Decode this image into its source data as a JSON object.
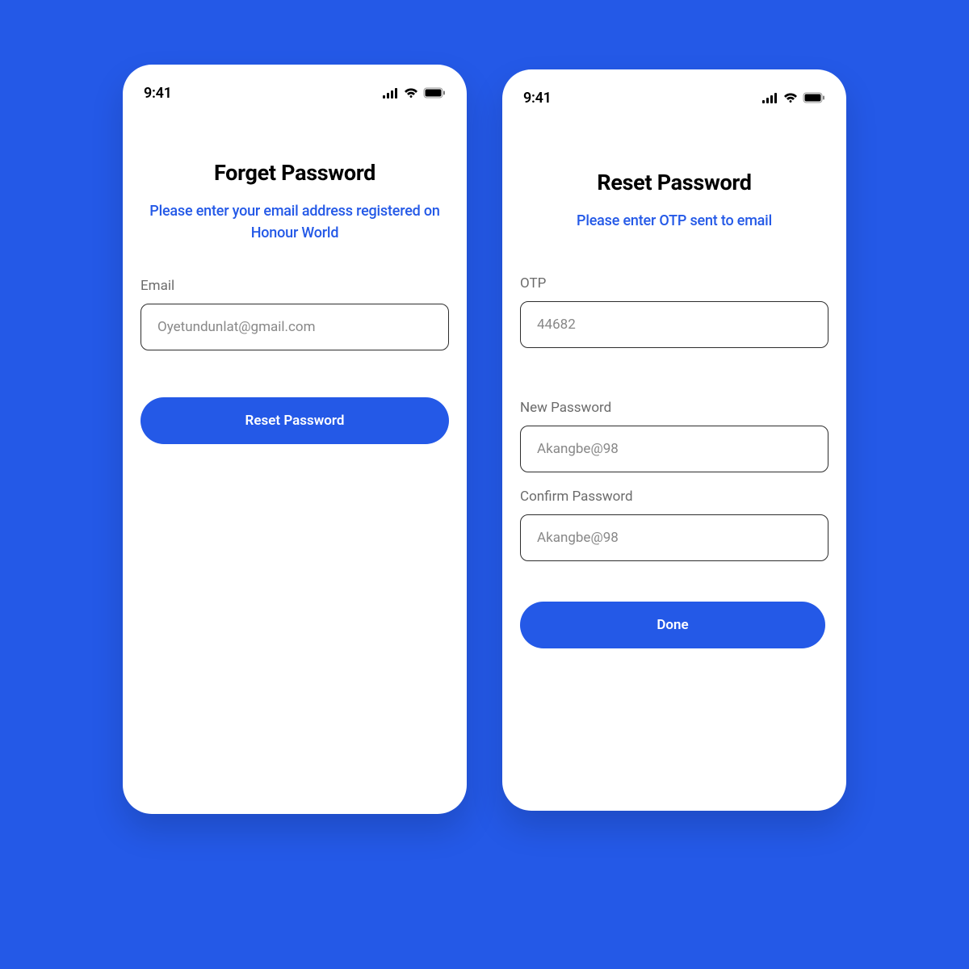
{
  "status": {
    "time": "9:41"
  },
  "screen1": {
    "title": "Forget Password",
    "subtitle": "Please enter your email address registered on Honour World",
    "email_label": "Email",
    "email_placeholder": "Oyetundunlat@gmail.com",
    "button_label": "Reset Password"
  },
  "screen2": {
    "title": "Reset Password",
    "subtitle": "Please enter OTP sent to email",
    "otp_label": "OTP",
    "otp_placeholder": "44682",
    "newpass_label": "New Password",
    "newpass_placeholder": "Akangbe@98",
    "confirmpass_label": "Confirm  Password",
    "confirmpass_placeholder": "Akangbe@98",
    "button_label": "Done"
  }
}
